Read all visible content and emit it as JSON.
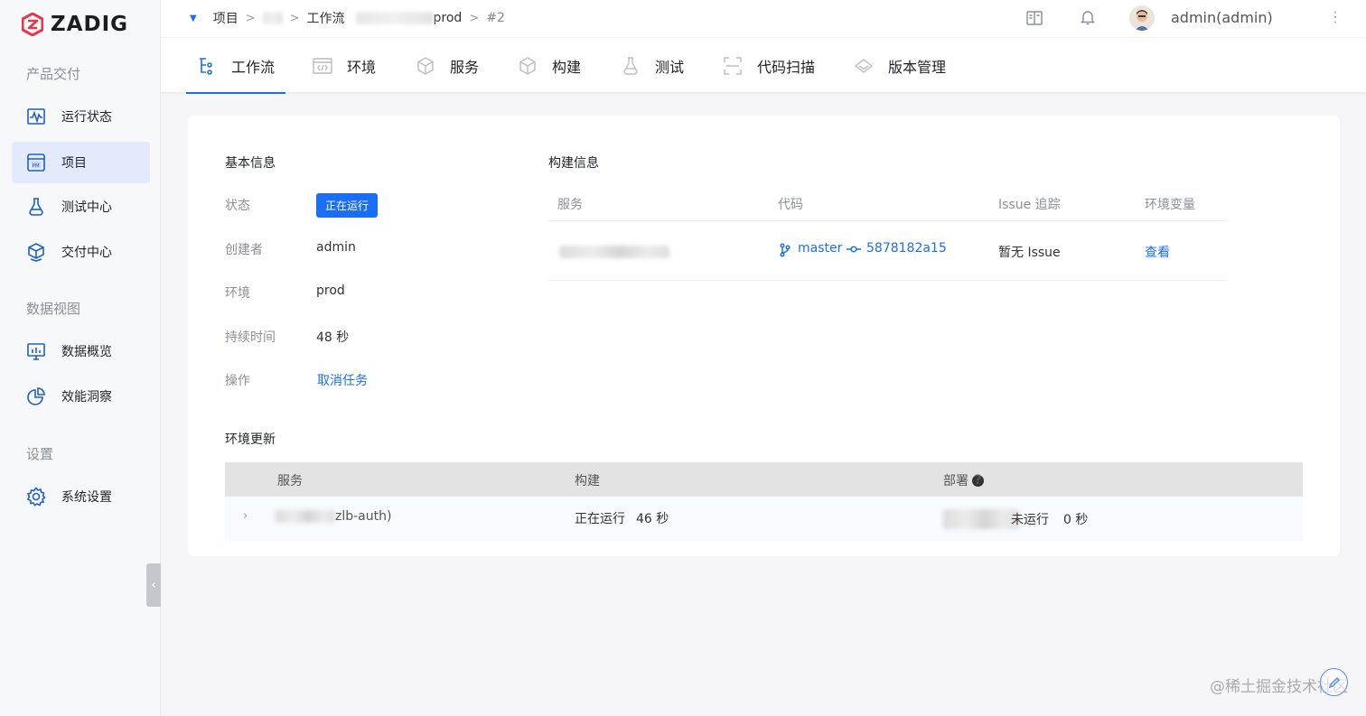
{
  "brand": {
    "name": "ZADIG",
    "color": "#e5374a"
  },
  "colors": {
    "accent": "#1a6ef5",
    "muted": "#8a8f99"
  },
  "sidebar": {
    "sections": [
      {
        "label": "产品交付"
      },
      {
        "label": "数据视图"
      },
      {
        "label": "设置"
      }
    ],
    "items": [
      {
        "label": "运行状态",
        "icon": "activity-monitor-icon"
      },
      {
        "label": "项目",
        "icon": "project-pm-icon"
      },
      {
        "label": "测试中心",
        "icon": "flask-icon"
      },
      {
        "label": "交付中心",
        "icon": "delivery-box-icon"
      },
      {
        "label": "数据概览",
        "icon": "dashboard-chart-icon"
      },
      {
        "label": "效能洞察",
        "icon": "pie-chart-icon"
      },
      {
        "label": "系统设置",
        "icon": "gear-icon"
      }
    ],
    "collapse_glyph": "‹"
  },
  "breadcrumb": {
    "project": "项目",
    "workflow": "工作流",
    "env_suffix": "prod",
    "run": "#2",
    "sep": ">"
  },
  "header": {
    "user": "admin(admin)",
    "icons": [
      "docs-book-icon",
      "bell-icon",
      "more-vertical-icon"
    ]
  },
  "tabs": [
    {
      "label": "工作流",
      "icon": "workflow-icon",
      "active": true
    },
    {
      "label": "环境",
      "icon": "environment-code-icon"
    },
    {
      "label": "服务",
      "icon": "service-cube-icon"
    },
    {
      "label": "构建",
      "icon": "build-box-icon"
    },
    {
      "label": "测试",
      "icon": "test-flask-icon"
    },
    {
      "label": "代码扫描",
      "icon": "code-scan-icon"
    },
    {
      "label": "版本管理",
      "icon": "version-diamond-icon"
    }
  ],
  "basic_info": {
    "title": "基本信息",
    "status_label": "状态",
    "status_value": "正在运行",
    "creator_label": "创建者",
    "creator_value": "admin",
    "env_label": "环境",
    "env_value": "prod",
    "duration_label": "持续时间",
    "duration_value": "48 秒",
    "action_label": "操作",
    "action_value": "取消任务"
  },
  "build_info": {
    "title": "构建信息",
    "columns": [
      "服务",
      "代码",
      "Issue 追踪",
      "环境变量"
    ],
    "row": {
      "branch": "master",
      "commit": "5878182a15",
      "issue": "暂无 Issue",
      "env_vars": "查看"
    }
  },
  "env_update": {
    "title": "环境更新",
    "columns": [
      "服务",
      "构建",
      "部署"
    ],
    "row": {
      "service_suffix": "zlb-auth)",
      "build_status": "正在运行",
      "build_time": "46 秒",
      "deploy_status_suffix": "未运行",
      "deploy_time": "0 秒"
    }
  },
  "watermark": "@稀土掘金技术社区"
}
